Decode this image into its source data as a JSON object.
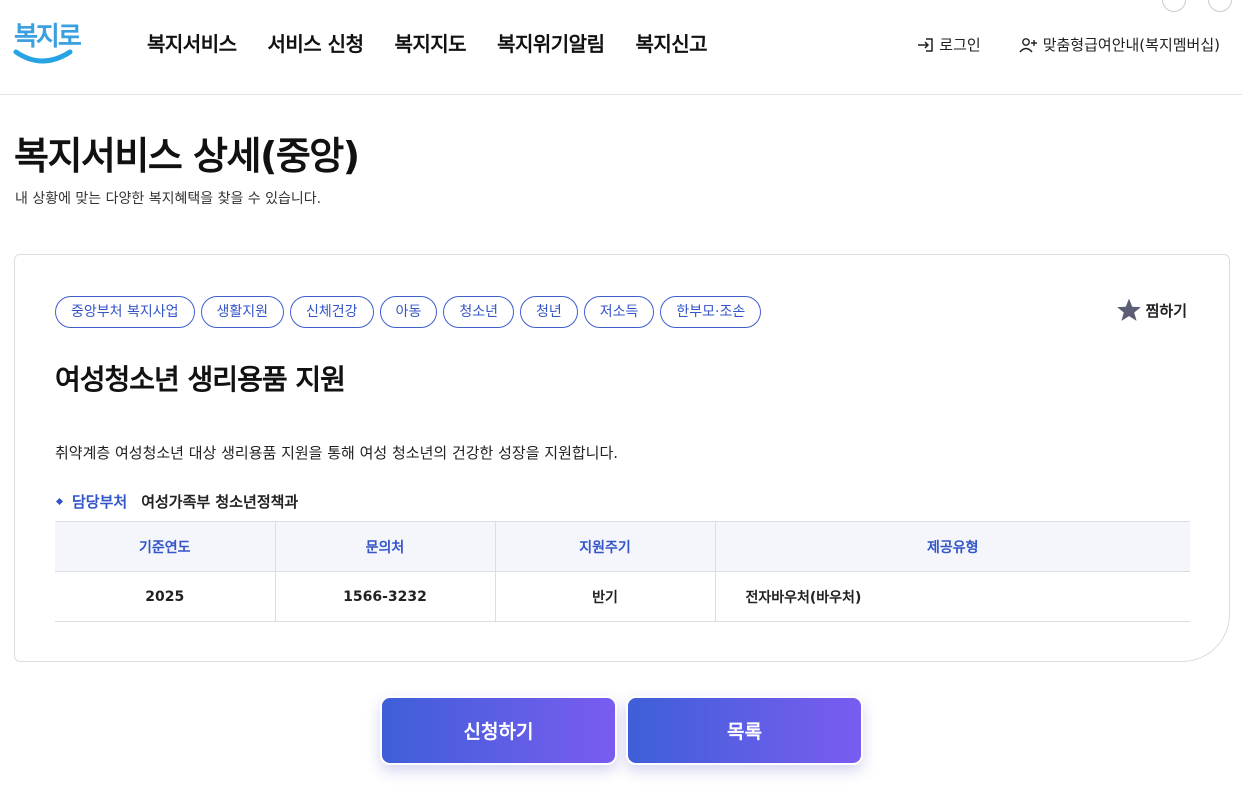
{
  "header": {
    "logo_text": "복지로",
    "nav": [
      "복지서비스",
      "서비스 신청",
      "복지지도",
      "복지위기알림",
      "복지신고"
    ],
    "login_label": "로그인",
    "membership_label": "맞춤형급여안내(복지멤버십)"
  },
  "page": {
    "title": "복지서비스 상세(중앙)",
    "description": "내 상황에 맞는 다양한 복지혜택을 찾을 수 있습니다."
  },
  "service": {
    "tags": [
      "중앙부처 복지사업",
      "생활지원",
      "신체건강",
      "아동",
      "청소년",
      "청년",
      "저소득",
      "한부모·조손"
    ],
    "favorite_label": "찜하기",
    "title": "여성청소년 생리용품 지원",
    "summary": "취약계층 여성청소년 대상 생리용품 지원을 통해 여성 청소년의 건강한 성장을 지원합니다.",
    "department_label": "담당부처",
    "department": "여성가족부 청소년정책과",
    "table": {
      "headers": [
        "기준연도",
        "문의처",
        "지원주기",
        "제공유형"
      ],
      "rows": [
        [
          "2025",
          "1566-3232",
          "반기",
          "전자바우처(바우처)"
        ]
      ]
    }
  },
  "actions": {
    "apply_label": "신청하기",
    "list_label": "목록"
  },
  "colors": {
    "accent": "#3455c8",
    "button_gradient_start": "#3e5fd8",
    "button_gradient_end": "#7a5cf0"
  }
}
